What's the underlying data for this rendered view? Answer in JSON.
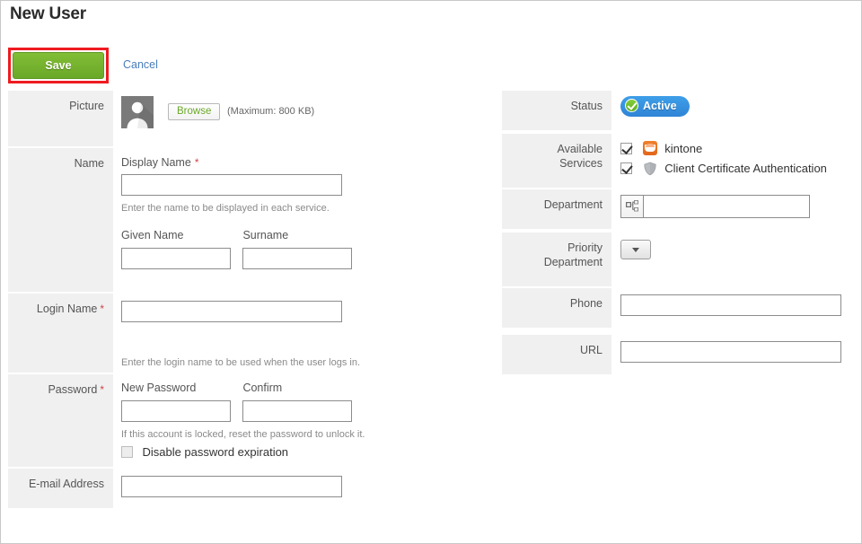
{
  "page": {
    "title": "New User"
  },
  "toolbar": {
    "save_label": "Save",
    "cancel_label": "Cancel",
    "save_highlight_color": "#ee1b20",
    "save_button_color": "#6aa828",
    "cancel_link_color": "#4a7ebb"
  },
  "left_column": {
    "picture": {
      "label": "Picture",
      "browse_label": "Browse",
      "max_note": "(Maximum: 800 KB)",
      "avatar_icon": "user-avatar-icon"
    },
    "name": {
      "label": "Name",
      "display_name_label": "Display Name",
      "display_name_required": "*",
      "display_name_value": "",
      "display_name_hint": "Enter the name to be displayed in each service.",
      "given_name_label": "Given Name",
      "given_name_value": "",
      "surname_label": "Surname",
      "surname_value": ""
    },
    "login_name": {
      "label": "Login Name",
      "required": "*",
      "value": "",
      "hint": "Enter the login name to be used when the user logs in."
    },
    "password": {
      "label": "Password",
      "required": "*",
      "new_password_label": "New Password",
      "new_password_value": "",
      "confirm_label": "Confirm",
      "confirm_value": "",
      "hint": "If this account is locked, reset the password to unlock it.",
      "disable_expiration_label": "Disable password expiration",
      "disable_expiration_checked": false
    },
    "email": {
      "label": "E-mail Address",
      "value": ""
    }
  },
  "right_column": {
    "status": {
      "label": "Status",
      "badge_text": "Active",
      "badge_bg_color": "#2f84d6",
      "badge_check_color": "#5fae1f",
      "check_icon": "check-circle-icon"
    },
    "available_services": {
      "label": "Available\nServices",
      "label_line1": "Available",
      "label_line2": "Services",
      "items": [
        {
          "name": "kintone",
          "checked": true,
          "icon": "kintone-icon"
        },
        {
          "name": "Client Certificate Authentication",
          "checked": true,
          "icon": "shield-icon"
        }
      ]
    },
    "department": {
      "label": "Department",
      "value": "",
      "picker_icon": "org-tree-picker-icon"
    },
    "priority_department": {
      "label_line1": "Priority",
      "label_line2": "Department",
      "dropdown_icon": "chevron-down-icon",
      "selected": ""
    },
    "phone": {
      "label": "Phone",
      "value": ""
    },
    "url": {
      "label": "URL",
      "value": ""
    }
  }
}
